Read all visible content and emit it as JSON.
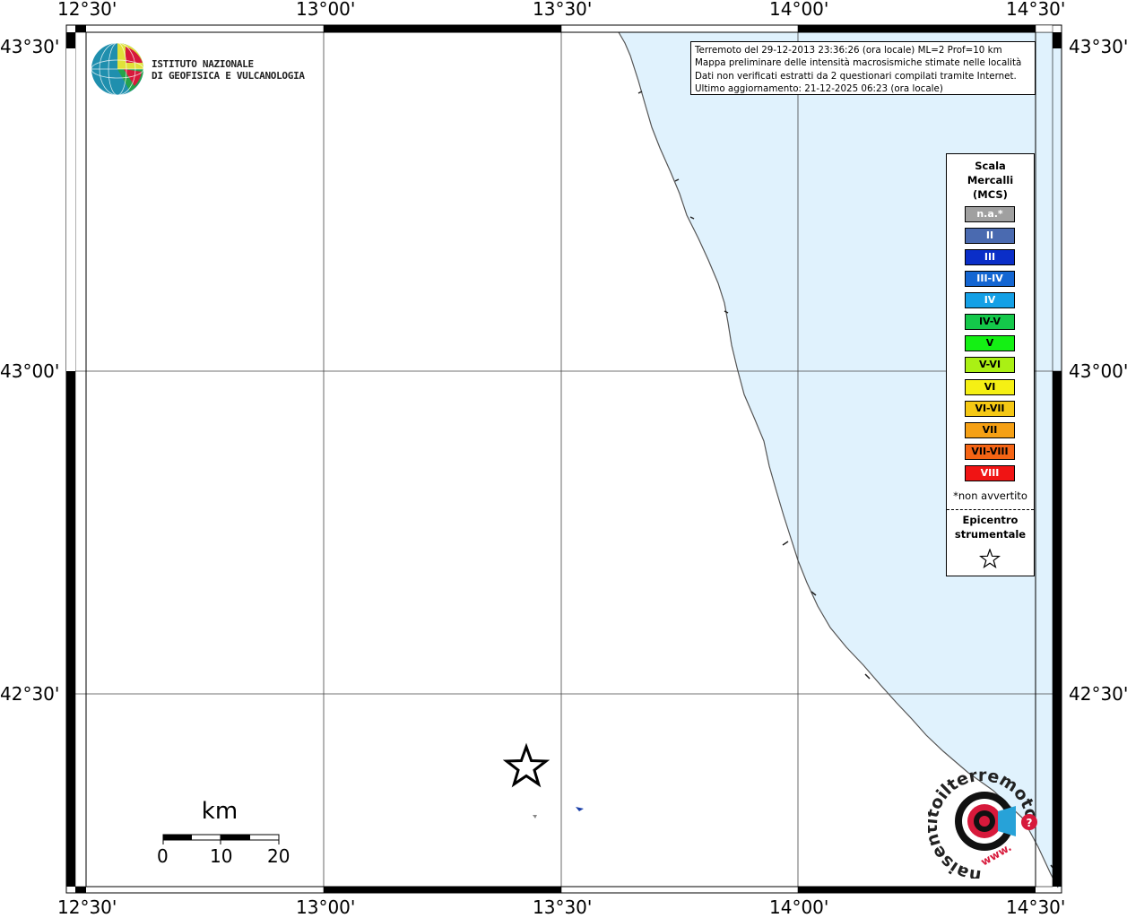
{
  "map": {
    "lon_ticks": [
      "12°30'",
      "13°00'",
      "13°30'",
      "14°00'",
      "14°30'"
    ],
    "lat_ticks": [
      "43°30'",
      "43°00'",
      "42°30'"
    ]
  },
  "logo": {
    "line1": "ISTITUTO NAZIONALE",
    "line2": "DI GEOFISICA E VULCANOLOGIA"
  },
  "info": {
    "line1": "Terremoto del 29-12-2013 23:36:26 (ora locale) ML=2 Prof=10 km",
    "line2": "Mappa preliminare delle intensità macrosismiche stimate nelle località",
    "line3": "Dati non verificati estratti da 2 questionari compilati tramite Internet.",
    "line4": "Ultimo aggiornamento: 21-12-2025 06:23 (ora locale)"
  },
  "legend": {
    "title": "Scala\nMercalli\n(MCS)",
    "items": [
      {
        "label": "n.a.*",
        "color": "#a0a0a0"
      },
      {
        "label": "II",
        "color": "#4a6ab0"
      },
      {
        "label": "III",
        "color": "#0a2ec8"
      },
      {
        "label": "III-IV",
        "color": "#1466d2"
      },
      {
        "label": "IV",
        "color": "#14a0e6"
      },
      {
        "label": "IV-V",
        "color": "#14c84a"
      },
      {
        "label": "V",
        "color": "#14f014"
      },
      {
        "label": "V-VI",
        "color": "#aaf014"
      },
      {
        "label": "VI",
        "color": "#f5f014"
      },
      {
        "label": "VI-VII",
        "color": "#f5c814"
      },
      {
        "label": "VII",
        "color": "#f5a014"
      },
      {
        "label": "VII-VIII",
        "color": "#f56414"
      },
      {
        "label": "VIII",
        "color": "#f01414"
      }
    ],
    "note": "*non avvertito",
    "epicentre_label": "Epicentro\nstrumentale"
  },
  "scalebar": {
    "unit": "km",
    "labels": [
      "0",
      "10",
      "20"
    ]
  },
  "colors": {
    "sea": "#e0f2fd",
    "coast": "#555555"
  },
  "hai_logo": {
    "text": "haisentitoilterremoto.it",
    "url_text": "www."
  }
}
